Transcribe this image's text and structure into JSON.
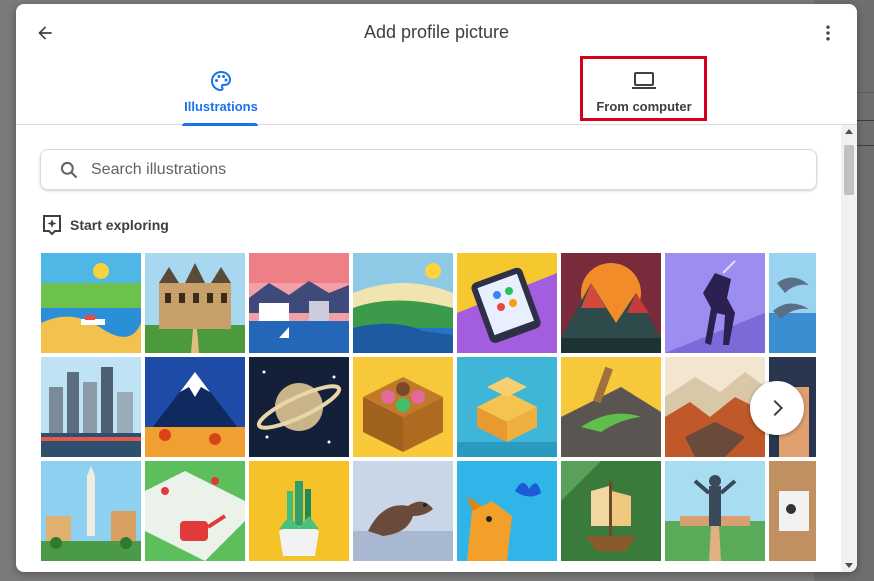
{
  "dialog": {
    "title": "Add profile picture",
    "back_icon": "arrow-back-icon",
    "more_icon": "more-vert-icon"
  },
  "tabs": [
    {
      "label": "Illustrations",
      "icon": "palette-icon",
      "selected": true
    },
    {
      "label": "From computer",
      "icon": "laptop-icon",
      "selected": false
    }
  ],
  "search": {
    "placeholder": "Search illustrations",
    "value": ""
  },
  "section": {
    "label": "Start exploring",
    "icon": "sparkle-icon"
  },
  "illustrations": [
    "beach-boat",
    "castle",
    "city-harbor",
    "coast-landscape",
    "smartphone",
    "mountains-sunset",
    "unicorn",
    "dolphins",
    "city-skyline",
    "snowy-mountain",
    "saturn",
    "donut-box",
    "isometric-buildings",
    "lizard-rock",
    "rocky-cliffs",
    "partial-tile",
    "monument-city",
    "garden-watering-can",
    "cactus-plant",
    "otter",
    "dog-butterfly",
    "sailing-ship",
    "statue-park",
    "partial-tile"
  ],
  "colors": {
    "accent": "#1a73e8",
    "highlight": "#d6001c"
  }
}
